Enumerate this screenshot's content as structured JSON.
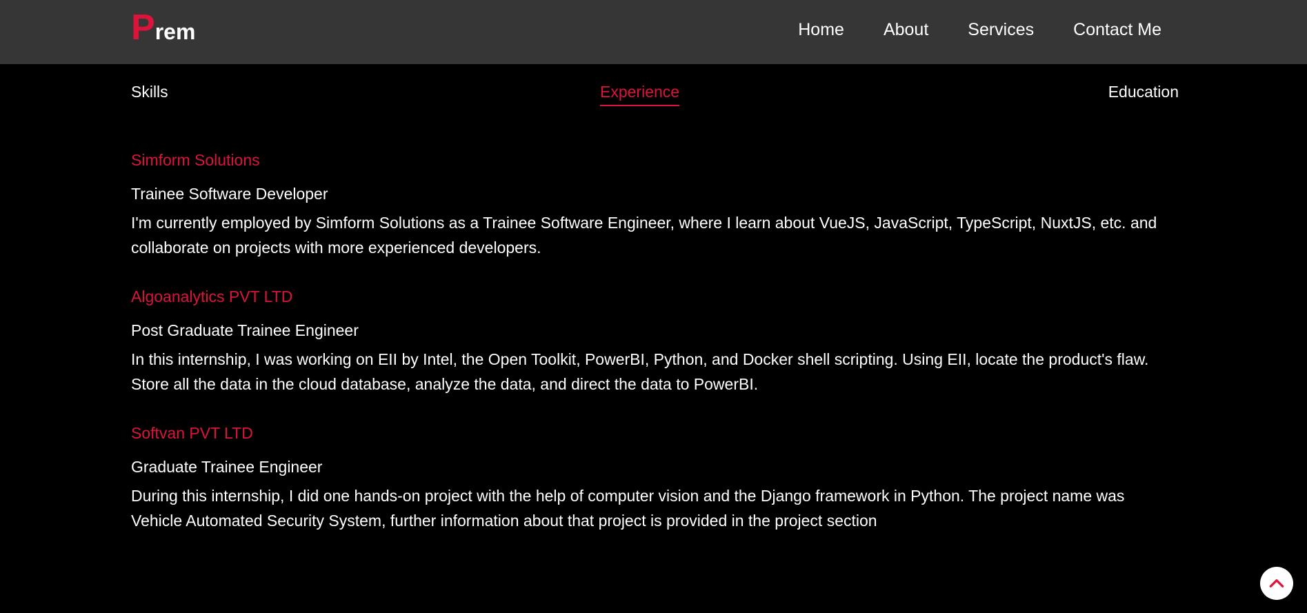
{
  "header": {
    "logo_initial": "P",
    "logo_rest": "rem",
    "nav": [
      {
        "label": "Home"
      },
      {
        "label": "About"
      },
      {
        "label": "Services"
      },
      {
        "label": "Contact Me"
      }
    ]
  },
  "tabs": {
    "skills": "Skills",
    "experience": "Experience",
    "education": "Education",
    "active": "Experience"
  },
  "experience": [
    {
      "company": "Simform Solutions",
      "role": "Trainee Software Developer",
      "description": "I'm currently employed by Simform Solutions as a Trainee Software Engineer, where I learn about VueJS, JavaScript, TypeScript, NuxtJS, etc. and collaborate on projects with more experienced developers."
    },
    {
      "company": "Algoanalytics PVT LTD",
      "role": "Post Graduate Trainee Engineer",
      "description": "In this internship, I was working on EII by Intel, the Open Toolkit, PowerBI, Python, and Docker shell scripting. Using EII, locate the product's flaw. Store all the data in the cloud database, analyze the data, and direct the data to PowerBI."
    },
    {
      "company": "Softvan PVT LTD",
      "role": "Graduate Trainee Engineer",
      "description": "During this internship, I did one hands-on project with the help of computer vision and the Django framework in Python. The project name was Vehicle Automated Security System, further information about that project is provided in the project section"
    }
  ],
  "scroll_top": {
    "icon": "chevron-up-icon"
  },
  "colors": {
    "accent": "#dc143c",
    "navbar_bg": "#363636",
    "page_bg": "#000000",
    "text": "#ffffff"
  }
}
